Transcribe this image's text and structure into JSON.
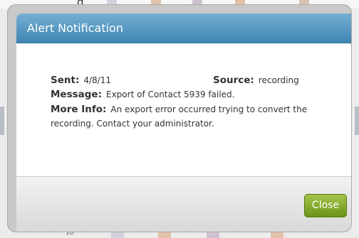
{
  "background": {
    "header_partial_text": "g",
    "row_number": "10",
    "stripe_colors": [
      "#cfcfd6",
      "#e8c6a8",
      "#cdbfcf",
      "#e8c6a8",
      "#d7c3b2"
    ]
  },
  "dialog": {
    "title": "Alert Notification",
    "title_color": "#4a90bf",
    "sent": {
      "label": "Sent:",
      "value": "4/8/11"
    },
    "source": {
      "label": "Source:",
      "value": "recording"
    },
    "message": {
      "label": "Message:",
      "value": "Export of Contact 5939 failed."
    },
    "more_info": {
      "label": "More Info:",
      "value": "An export error occurred trying to convert the recording. Contact your administrator."
    },
    "close_label": "Close",
    "close_color": "#7ea02c"
  }
}
